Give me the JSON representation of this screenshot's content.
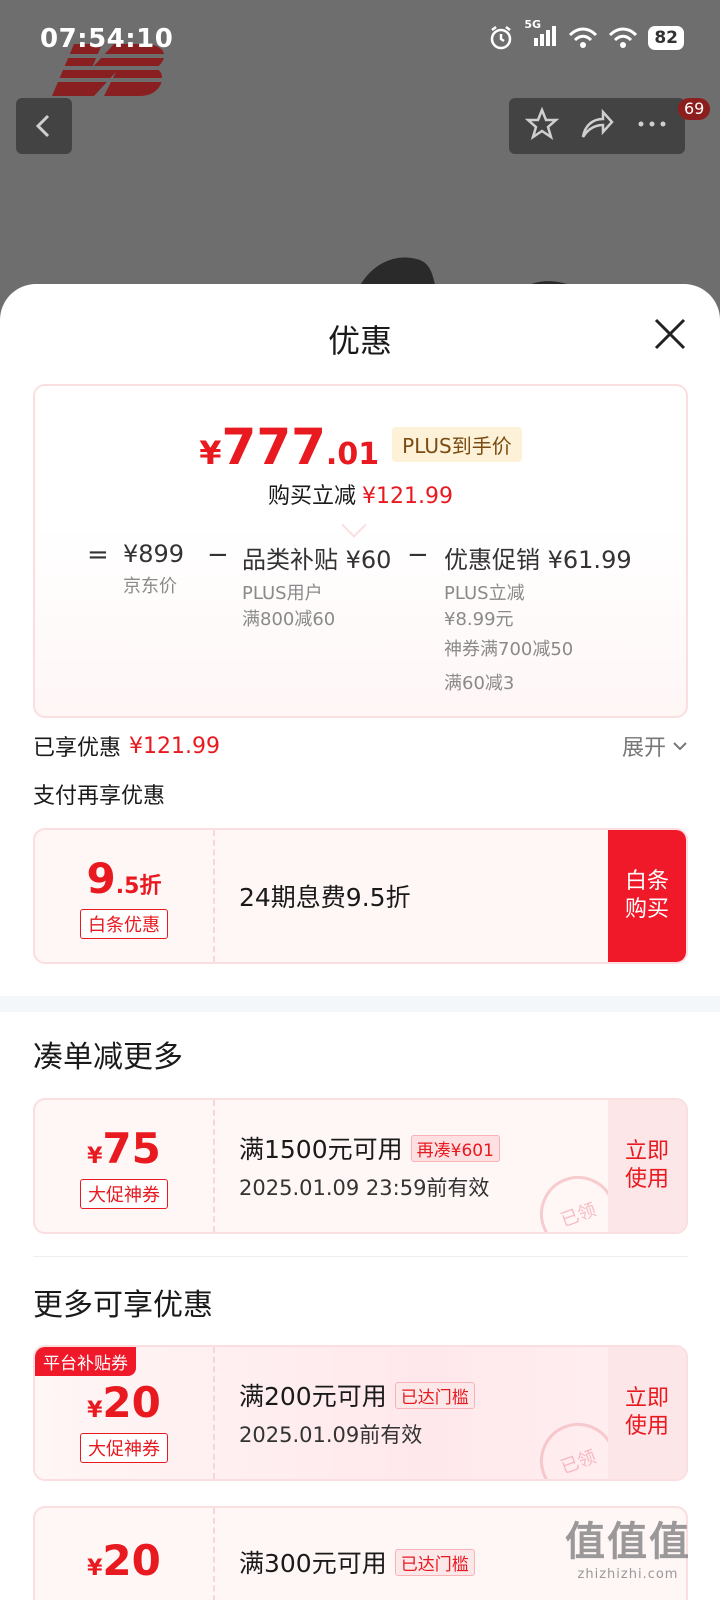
{
  "status_bar": {
    "time": "07:54:10",
    "battery": "82",
    "network": "5G"
  },
  "header": {
    "badge_count": "69"
  },
  "sheet": {
    "title": "优惠",
    "price_card": {
      "price_yen": "¥",
      "price_int": "777",
      "price_dec": ".01",
      "plus_tag": "PLUS到手价",
      "save_label": "购买立减",
      "save_amount": "¥121.99",
      "breakdown": {
        "eq": "=",
        "minus": "−",
        "jd_price": "¥899",
        "jd_price_label": "京东价",
        "subsidy_title": "品类补贴 ¥60",
        "subsidy_line1": "PLUS用户",
        "subsidy_line2": "满800减60",
        "promo_title": "优惠促销 ¥61.99",
        "promo_line1": "PLUS立减",
        "promo_line2": "¥8.99元",
        "promo_line3": "神券满700减50",
        "promo_line4": "满60减3"
      }
    },
    "enjoyed": {
      "label": "已享优惠",
      "amount": "¥121.99",
      "expand": "展开"
    },
    "pay_more_label": "支付再享优惠",
    "baitiao": {
      "big": "9",
      "suffix": ".5折",
      "tag": "白条优惠",
      "title": "24期息费9.5折",
      "button_line1": "白条",
      "button_line2": "购买"
    },
    "section_combine": "凑单减更多",
    "coupon_combine": {
      "yen": "¥",
      "amount": "75",
      "tag": "大促神券",
      "title": "满1500元可用",
      "extra_tag": "再凑¥601",
      "date": "2025.01.09 23:59前有效",
      "button_line1": "立即",
      "button_line2": "使用",
      "stamp": "已领"
    },
    "section_more": "更多可享优惠",
    "coupon_more1": {
      "badge": "平台补贴券",
      "yen": "¥",
      "amount": "20",
      "tag": "大促神券",
      "title": "满200元可用",
      "extra_tag": "已达门槛",
      "date": "2025.01.09前有效",
      "button_line1": "立即",
      "button_line2": "使用",
      "stamp": "已领"
    },
    "coupon_more2": {
      "yen": "¥",
      "amount": "20",
      "title": "满300元可用",
      "extra_tag": "已达门槛"
    }
  },
  "watermark": {
    "glyphs": "值值值",
    "text": "zhizhizhi.com"
  },
  "colors": {
    "accent": "#e8191f",
    "button_red": "#f0192a",
    "plus_bg": "#fdf1d8"
  }
}
